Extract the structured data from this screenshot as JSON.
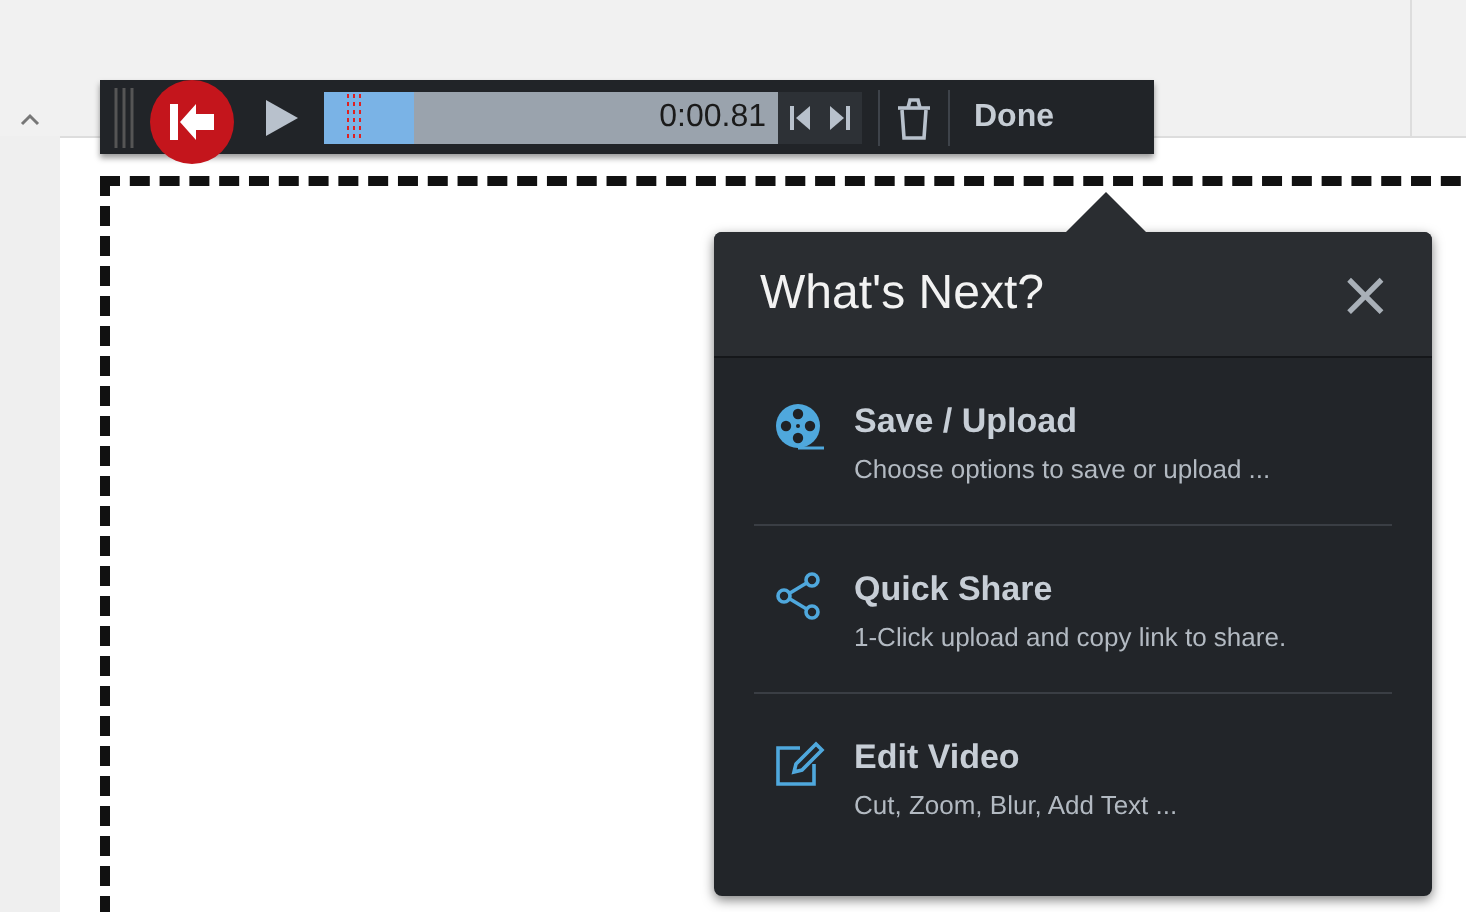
{
  "toolbar": {
    "time": "0:00.81",
    "level": 0.2,
    "done": "Done"
  },
  "popup": {
    "title": "What's Next?",
    "close": "×",
    "items": [
      {
        "kind": "reel",
        "title": "Save / Upload",
        "description": "Choose options to save or upload ..."
      },
      {
        "kind": "share",
        "title": "Quick Share",
        "description": "1-Click upload and copy link to share."
      },
      {
        "kind": "edit",
        "title": "Edit Video",
        "description": "Cut, Zoom, Blur, Add Text ..."
      }
    ]
  }
}
